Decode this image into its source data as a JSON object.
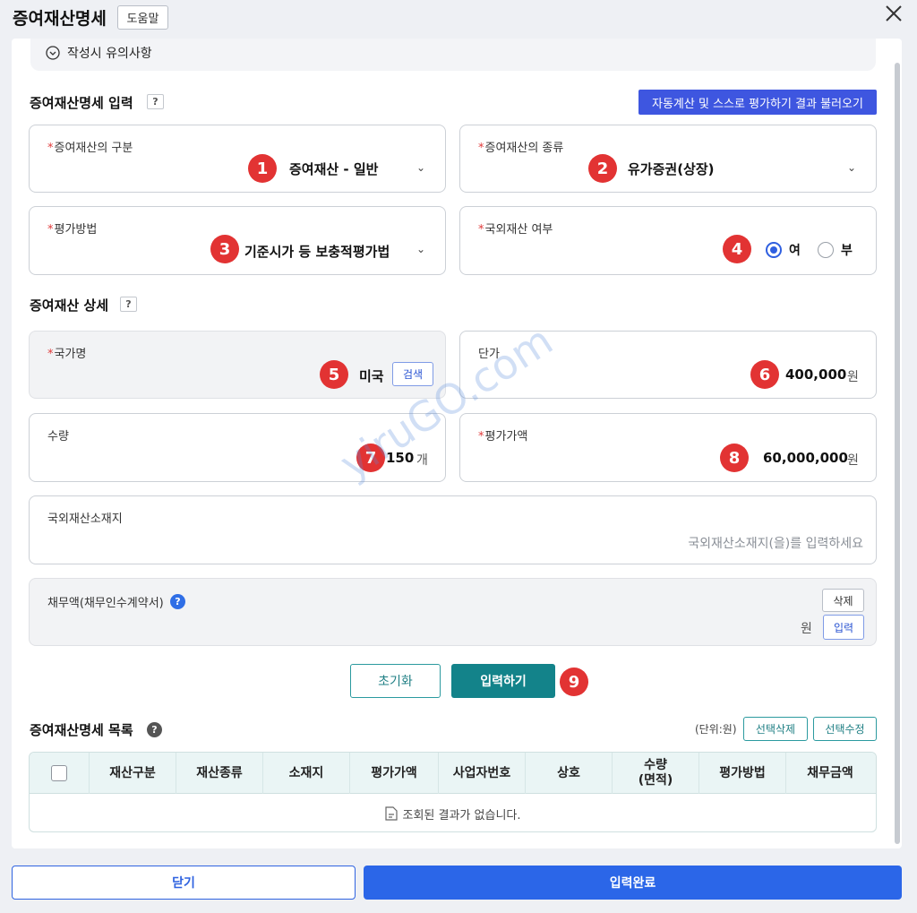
{
  "header": {
    "title": "증여재산명세",
    "help_label": "도움말"
  },
  "notice": {
    "label": "작성시 유의사항"
  },
  "input_section": {
    "title": "증여재산명세 입력",
    "help_mark": "?",
    "load_button": "자동계산 및 스스로 평가하기 결과 불러오기"
  },
  "fields": {
    "category": {
      "label": "증여재산의 구분",
      "value": "증여재산 - 일반",
      "badge": "1"
    },
    "type": {
      "label": "증여재산의 종류",
      "value": "유가증권(상장)",
      "badge": "2"
    },
    "method": {
      "label": "평가방법",
      "value": "기준시가 등 보충적평가법",
      "badge": "3"
    },
    "foreign": {
      "label": "국외재산 여부",
      "badge": "4",
      "options": [
        "여",
        "부"
      ],
      "selected": "여"
    }
  },
  "detail_section": {
    "title": "증여재산 상세",
    "help_mark": "?"
  },
  "details": {
    "country": {
      "label": "국가명",
      "value": "미국",
      "search_label": "검색",
      "badge": "5"
    },
    "unit_price": {
      "label": "단가",
      "value": "400,000",
      "unit": "원",
      "badge": "6"
    },
    "quantity": {
      "label": "수량",
      "value": "150",
      "unit": "개",
      "badge": "7"
    },
    "eval_amount": {
      "label": "평가가액",
      "value": "60,000,000",
      "unit": "원",
      "badge": "8"
    },
    "location": {
      "label": "국외재산소재지",
      "placeholder": "국외재산소재지(을)를 입력하세요"
    },
    "debt": {
      "label": "채무액(채무인수계약서)",
      "help_mark": "?",
      "unit": "원",
      "delete_label": "삭제",
      "input_label": "입력"
    }
  },
  "actions": {
    "reset_label": "초기화",
    "input_label": "입력하기",
    "badge": "9"
  },
  "list_section": {
    "title": "증여재산명세 목록",
    "help_mark": "?",
    "unit_label": "(단위:원)",
    "delete_selected": "선택삭제",
    "edit_selected": "선택수정",
    "columns": [
      "재산구분",
      "재산종류",
      "소재지",
      "평가가액",
      "사업자번호",
      "상호",
      "수량\n(면적)",
      "평가방법",
      "채무금액"
    ],
    "empty_text": "조회된 결과가 없습니다."
  },
  "footer": {
    "close_label": "닫기",
    "done_label": "입력완료"
  },
  "watermark": "yiruGO.com",
  "colors": {
    "accent_blue": "#2b66e8",
    "teal": "#13838a",
    "badge_red": "#e23333"
  }
}
